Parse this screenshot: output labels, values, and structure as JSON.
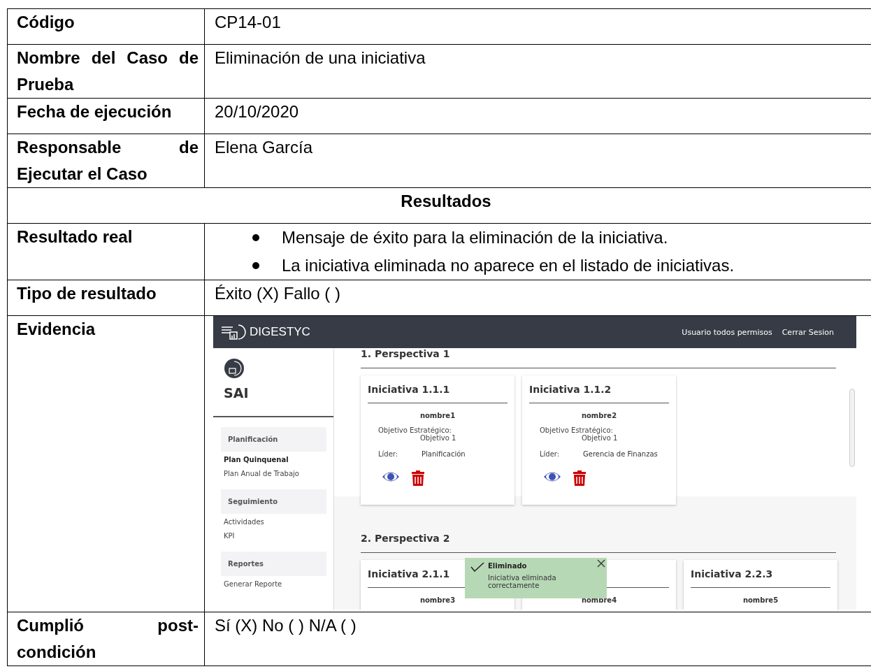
{
  "rows": [
    {
      "kind": "field",
      "label": "Código",
      "value": "CP14-01"
    },
    {
      "kind": "field",
      "label": "Nombre del Caso de Prueba",
      "value": "Eliminación de una iniciativa"
    },
    {
      "kind": "field",
      "label": "Fecha de ejecución",
      "value": "20/10/2020"
    },
    {
      "kind": "field",
      "label": "Responsable de Ejecutar el Caso",
      "value": "Elena García"
    },
    {
      "kind": "heading",
      "label": "Resultados"
    },
    {
      "kind": "bullets",
      "label": "Resultado real",
      "items": [
        "Mensaje de éxito para la eliminación de la iniciativa.",
        "La iniciativa eliminada no aparece en el listado de iniciativas."
      ]
    },
    {
      "kind": "field",
      "label": "Tipo de resultado",
      "value": "Éxito (X) Fallo ( )"
    },
    {
      "kind": "evidence",
      "label": "Evidencia"
    },
    {
      "kind": "field",
      "label": "Cumplió post-condición",
      "value": "Sí (X) No ( )  N/A ( )"
    }
  ],
  "screenshot": {
    "brand": "DIGESTYC",
    "user": "Usuario todos permisos",
    "logout": "Cerrar Sesion",
    "app_name": "SAI",
    "sidebar": [
      {
        "title": "Planificación",
        "items": [
          {
            "label": "Plan Quinquenal",
            "selected": true
          },
          {
            "label": "Plan Anual de Trabajo",
            "selected": false
          }
        ]
      },
      {
        "title": "Seguimiento",
        "items": [
          {
            "label": "Actividades",
            "selected": false
          },
          {
            "label": "KPI",
            "selected": false
          }
        ]
      },
      {
        "title": "Reportes",
        "items": [
          {
            "label": "Generar Reporte",
            "selected": false
          }
        ]
      }
    ],
    "perspectives": [
      {
        "title": "1. Perspectiva 1",
        "cards": [
          {
            "title": "Iniciativa 1.1.1",
            "name": "nombre1",
            "objective_label": "Objetivo Estratégico:",
            "objective": "Objetivo 1",
            "leader_label": "Líder:",
            "leader": "Planificación"
          },
          {
            "title": "Iniciativa 1.1.2",
            "name": "nombre2",
            "objective_label": "Objetivo Estratégico:",
            "objective": "Objetivo 1",
            "leader_label": "Líder:",
            "leader": "Gerencia de Finanzas"
          }
        ]
      },
      {
        "title": "2. Perspectiva 2",
        "cards": [
          {
            "title": "Iniciativa 2.1.1",
            "name": "nombre3"
          },
          {
            "name": "nombre4"
          },
          {
            "title": "Iniciativa 2.2.3",
            "name": "nombre5"
          }
        ]
      }
    ],
    "toast": {
      "title": "Eliminado",
      "message": "Iniciativa eliminada correctamente"
    }
  }
}
